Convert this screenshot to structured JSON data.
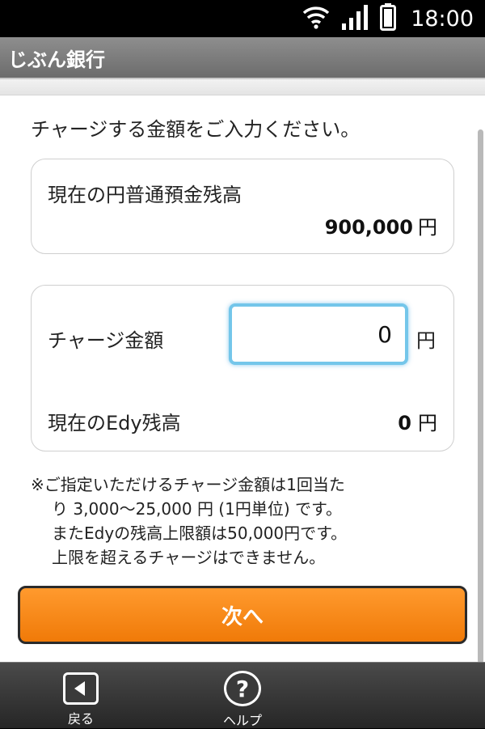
{
  "status_bar": {
    "time": "18:00",
    "wifi_icon": "wifi-icon",
    "signal_icon": "signal-icon",
    "battery_icon": "battery-icon"
  },
  "app": {
    "title": "じぶん銀行"
  },
  "instruction": "チャージする金額をご入力ください。",
  "balance": {
    "label": "現在の円普通預金残高",
    "amount": "900,000",
    "unit": "円"
  },
  "charge": {
    "label": "チャージ金額",
    "value": "0",
    "unit": "円"
  },
  "edy": {
    "label": "現在のEdy残高",
    "amount": "0",
    "unit": "円"
  },
  "notice": {
    "lines": [
      "※ご指定いただけるチャージ金額は1回当た",
      "り 3,000〜25,000 円 (1円単位) です。",
      "またEdyの残高上限額は50,000円です。",
      "上限を超えるチャージはできません。"
    ]
  },
  "next_button": {
    "label": "次へ"
  },
  "bottom_nav": {
    "back": {
      "label": "戻る",
      "icon": "back-arrow-icon"
    },
    "help": {
      "label": "ヘルプ",
      "icon": "help-icon"
    }
  },
  "colors": {
    "accent": "#f07a08",
    "input_focus": "#74c6ea",
    "header": "#7a7a7a"
  }
}
